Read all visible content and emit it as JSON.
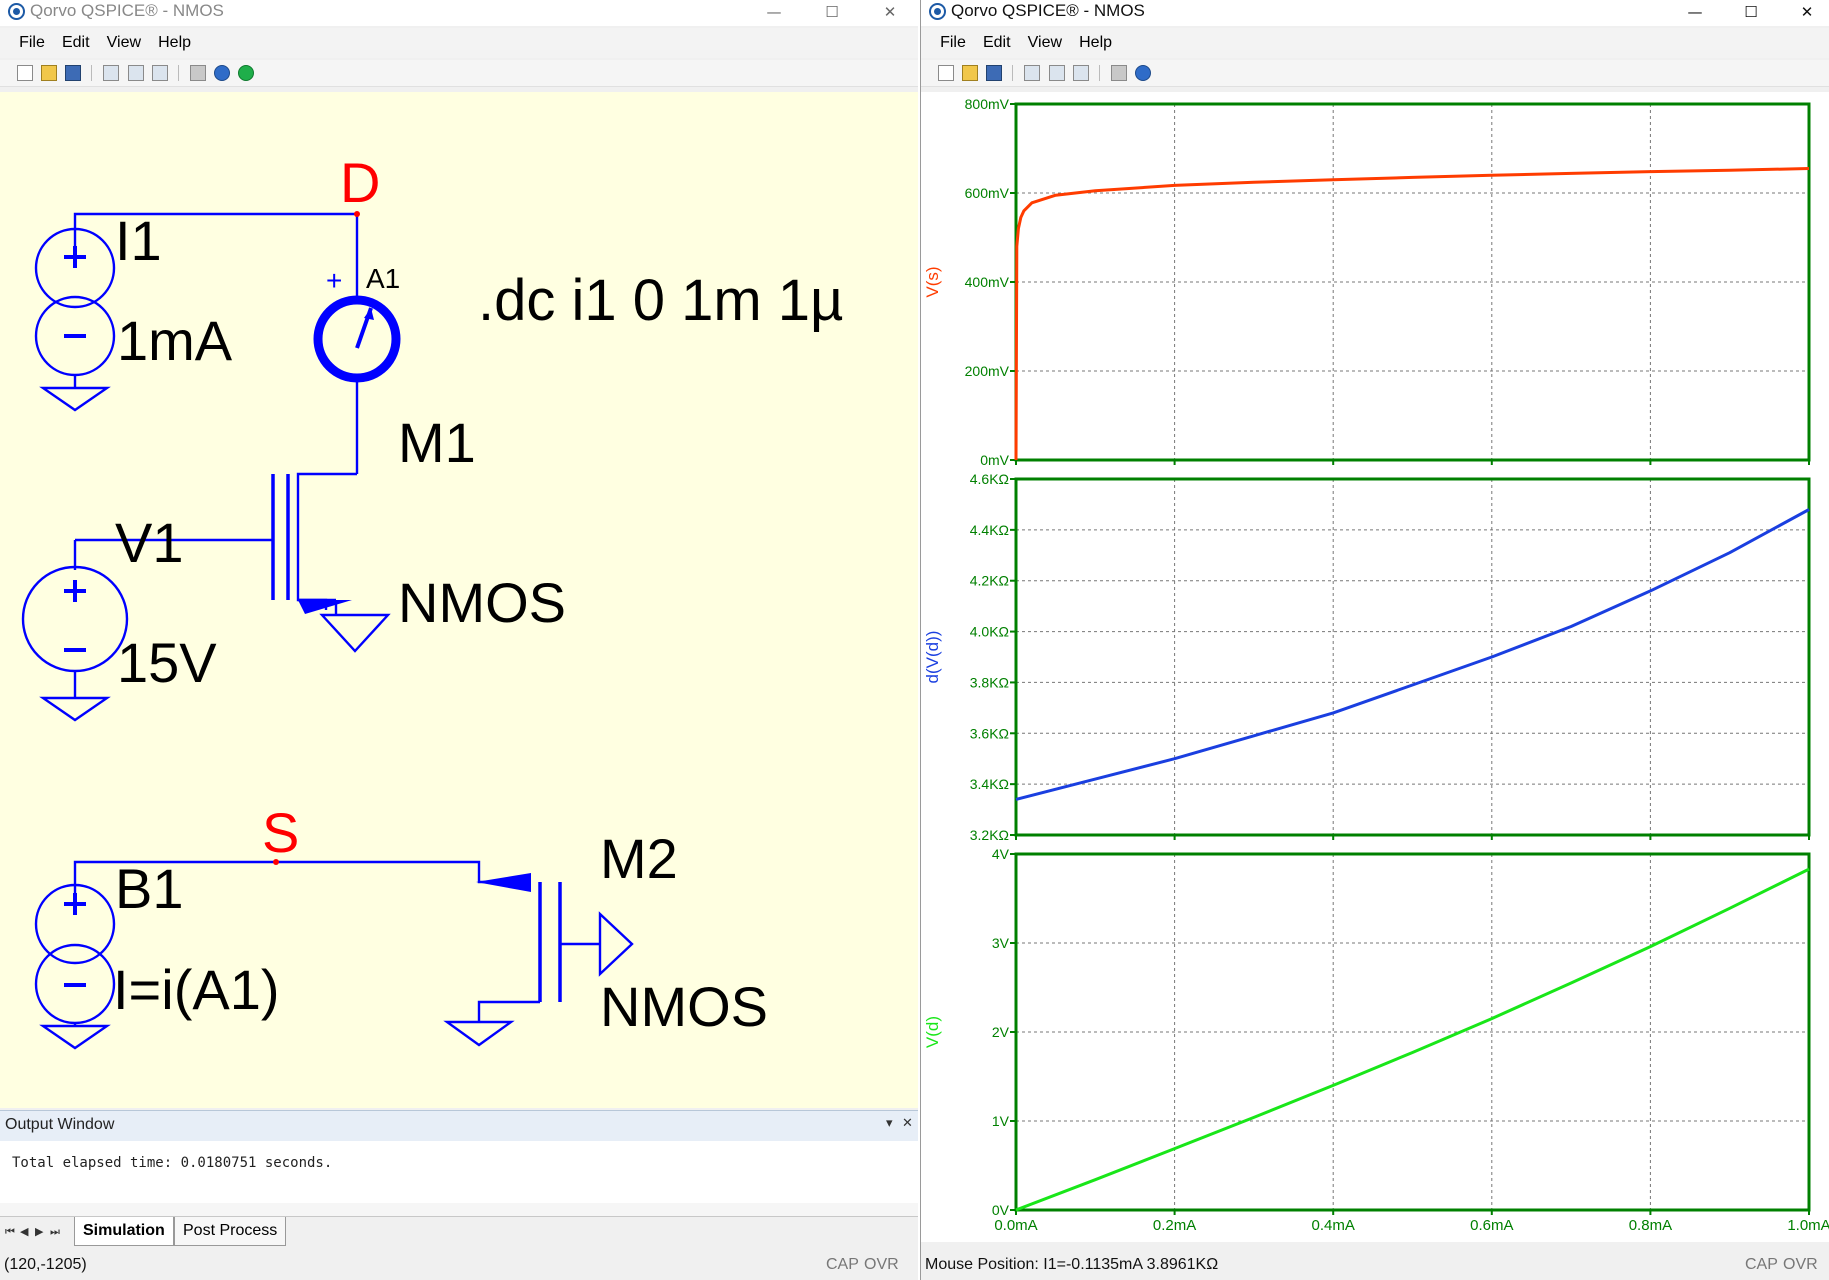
{
  "left_window": {
    "title": "Qorvo QSPICE® - NMOS",
    "controls": {
      "minimize": "—",
      "maximize": "☐",
      "close": "✕"
    },
    "menu": [
      "File",
      "Edit",
      "View",
      "Help"
    ],
    "schematic": {
      "node_d": "D",
      "node_s": "S",
      "i1_name": "I1",
      "i1_value": "1mA",
      "a1_name": "A1",
      "a1_plus": "+",
      "directive": ".dc i1 0 1m 1µ",
      "m1_name": "M1",
      "m1_model": "NMOS",
      "v1_name": "V1",
      "v1_value": "15V",
      "b1_name": "B1",
      "b1_value": "I=i(A1)",
      "m2_name": "M2",
      "m2_model": "NMOS"
    },
    "output_window": {
      "title": "Output Window",
      "pin": "▾",
      "close": "✕",
      "text": "Total elapsed time: 0.0180751 seconds."
    },
    "tab_nav": [
      "⏮",
      "◀",
      "▶",
      "⏭"
    ],
    "tabs": [
      {
        "label": "Simulation",
        "active": true
      },
      {
        "label": "Post Process",
        "active": false
      }
    ],
    "status": {
      "coords": "(120,-1205)",
      "cap": "CAP",
      "ovr": "OVR"
    }
  },
  "right_window": {
    "title": "Qorvo QSPICE® - NMOS",
    "controls": {
      "minimize": "—",
      "maximize": "☐",
      "close": "✕"
    },
    "menu": [
      "File",
      "Edit",
      "View",
      "Help"
    ],
    "status": {
      "mouse": "Mouse Position: I1=-0.1135mA  3.8961KΩ",
      "cap": "CAP",
      "ovr": "OVR"
    }
  },
  "colors": {
    "wire": "#0000ff",
    "node_label": "#ff0000",
    "schematic_bg": "#ffffe1",
    "plot_frame": "#008000",
    "trace_vs": "#ff3c00",
    "trace_dvd": "#1a3fe0",
    "trace_vd": "#19e619"
  },
  "chart_data": [
    {
      "type": "line",
      "ylabel": "V(s)",
      "yticks": [
        "800mV",
        "600mV",
        "400mV",
        "200mV",
        "0mV"
      ],
      "ylim": [
        0,
        800
      ],
      "xticks": [
        "0.0mA",
        "0.2mA",
        "0.4mA",
        "0.6mA",
        "0.8mA",
        "1.0mA"
      ],
      "xlim": [
        0,
        1.0
      ],
      "grid": true,
      "series": [
        {
          "name": "V(s)",
          "x": [
            0,
            0.001,
            0.003,
            0.006,
            0.01,
            0.02,
            0.05,
            0.1,
            0.2,
            0.3,
            0.4,
            0.5,
            0.6,
            0.7,
            0.8,
            0.9,
            1.0
          ],
          "y": [
            0,
            480,
            520,
            545,
            560,
            578,
            595,
            605,
            617,
            624,
            630,
            635,
            640,
            644,
            648,
            651,
            655
          ]
        }
      ]
    },
    {
      "type": "line",
      "ylabel": "d(V(d))",
      "yticks": [
        "4.6KΩ",
        "4.4KΩ",
        "4.2KΩ",
        "4.0KΩ",
        "3.8KΩ",
        "3.6KΩ",
        "3.4KΩ",
        "3.2KΩ"
      ],
      "ylim": [
        3.2,
        4.6
      ],
      "xticks": [
        "0.0mA",
        "0.2mA",
        "0.4mA",
        "0.6mA",
        "0.8mA",
        "1.0mA"
      ],
      "xlim": [
        0,
        1.0
      ],
      "grid": true,
      "series": [
        {
          "name": "d(V(d))",
          "x": [
            0,
            0.1,
            0.2,
            0.3,
            0.4,
            0.5,
            0.6,
            0.7,
            0.8,
            0.9,
            1.0
          ],
          "y": [
            3.34,
            3.42,
            3.5,
            3.59,
            3.68,
            3.79,
            3.9,
            4.02,
            4.16,
            4.31,
            4.48
          ]
        }
      ]
    },
    {
      "type": "line",
      "ylabel": "V(d)",
      "yticks": [
        "4V",
        "3V",
        "2V",
        "1V",
        "0V"
      ],
      "ylim": [
        0,
        4
      ],
      "xticks": [
        "0.0mA",
        "0.2mA",
        "0.4mA",
        "0.6mA",
        "0.8mA",
        "1.0mA"
      ],
      "xlim": [
        0,
        1.0
      ],
      "grid": true,
      "series": [
        {
          "name": "V(d)",
          "x": [
            0,
            0.1,
            0.2,
            0.3,
            0.4,
            0.5,
            0.6,
            0.7,
            0.8,
            0.9,
            1.0
          ],
          "y": [
            0,
            0.34,
            0.69,
            1.04,
            1.4,
            1.77,
            2.15,
            2.55,
            2.96,
            3.39,
            3.83
          ]
        }
      ]
    }
  ]
}
